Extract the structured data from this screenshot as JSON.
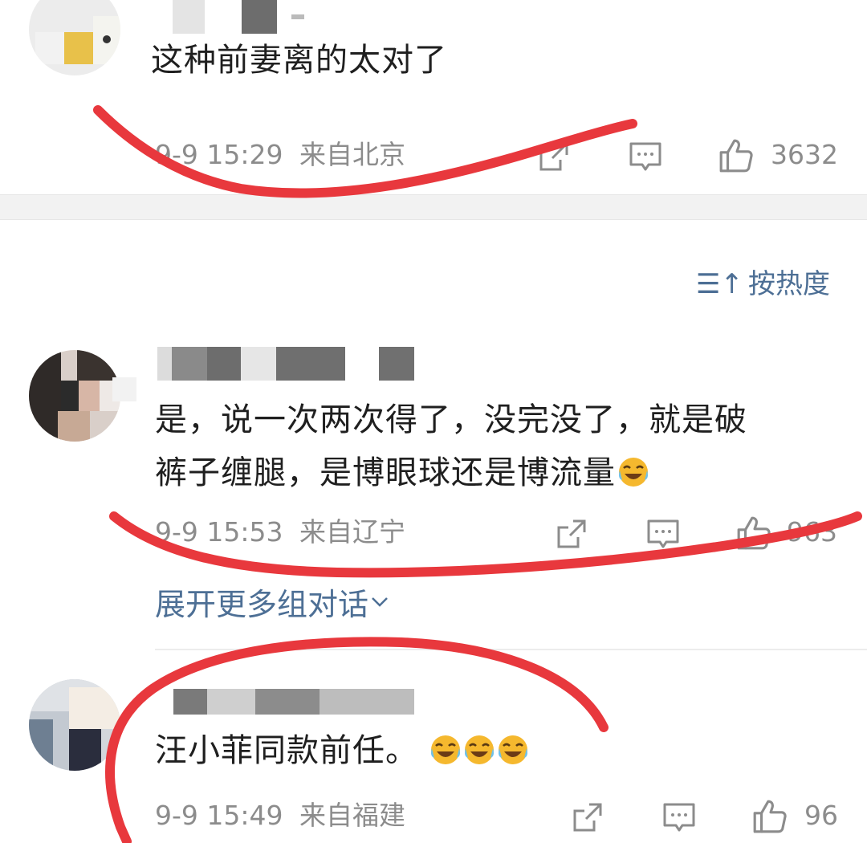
{
  "comments": [
    {
      "text": "这种前妻离的太对了",
      "time": "9-9 15:29",
      "location": "来自北京",
      "likes": "3632"
    },
    {
      "text_line1": "是，说一次两次得了，没完没了，就是破",
      "text_line2": "裤子缠腿，是博眼球还是博流量",
      "time": "9-9 15:53",
      "location": "来自辽宁",
      "likes": "963"
    },
    {
      "text": "汪小菲同款前任。",
      "time": "9-9 15:49",
      "location": "来自福建",
      "likes": "96"
    }
  ],
  "sort": {
    "icon": "sort-icon",
    "label": "按热度"
  },
  "expand": {
    "label": "展开更多组对话"
  },
  "icons": [
    "share-icon",
    "comment-icon",
    "thumbs-up-icon",
    "laugh-cry-emoji-icon",
    "chevron-down-icon"
  ],
  "colors": {
    "link": "#4d6f95",
    "meta": "#8c8c8c",
    "annotation": "#e8383d",
    "emoji": "#f5b82e"
  }
}
